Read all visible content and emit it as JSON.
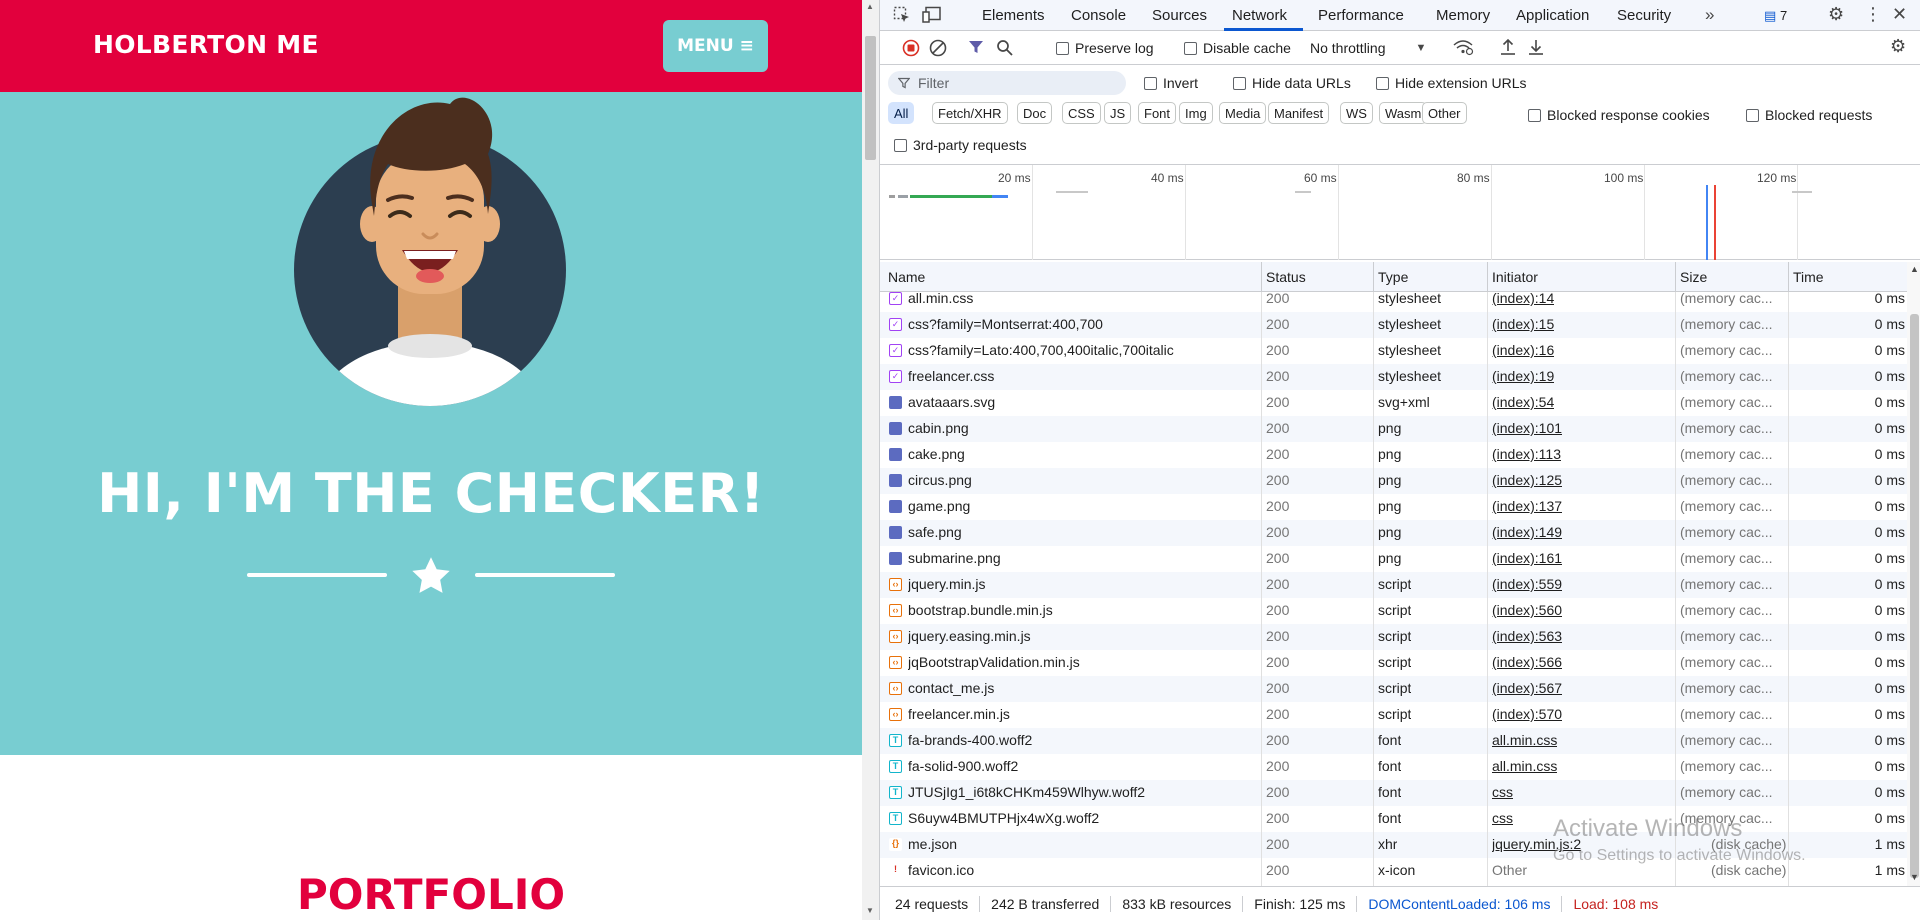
{
  "site": {
    "brand": "HOLBERTON ME",
    "menu_label": "MENU",
    "hero_title": "HI, I'M THE CHECKER!",
    "section_title": "PORTFOLIO",
    "colors": {
      "nav": "#e2003d",
      "hero": "#78cdd1",
      "accent": "#e2003d"
    }
  },
  "devtools": {
    "tabs": [
      {
        "label": "Elements"
      },
      {
        "label": "Console"
      },
      {
        "label": "Sources"
      },
      {
        "label": "Network"
      },
      {
        "label": "Performance"
      },
      {
        "label": "Memory"
      },
      {
        "label": "Application"
      },
      {
        "label": "Security"
      }
    ],
    "active_tab": "Network",
    "issues_count": "7",
    "toolbar": {
      "preserve_log": "Preserve log",
      "disable_cache": "Disable cache",
      "throttling": "No throttling"
    },
    "filter": {
      "placeholder": "Filter",
      "invert": "Invert",
      "hide_data_urls": "Hide data URLs",
      "hide_extension_urls": "Hide extension URLs",
      "blocked_response_cookies": "Blocked response cookies",
      "blocked_requests": "Blocked requests",
      "third_party": "3rd-party requests",
      "types": [
        "All",
        "Fetch/XHR",
        "Doc",
        "CSS",
        "JS",
        "Font",
        "Img",
        "Media",
        "Manifest",
        "WS",
        "Wasm",
        "Other"
      ],
      "active_type": "All"
    },
    "overview_ticks": [
      "20 ms",
      "40 ms",
      "60 ms",
      "80 ms",
      "100 ms",
      "120 ms"
    ],
    "columns": {
      "name": "Name",
      "status": "Status",
      "type": "Type",
      "initiator": "Initiator",
      "size": "Size",
      "time": "Time"
    },
    "requests": [
      {
        "name": "all.min.css",
        "status": "200",
        "type": "stylesheet",
        "initiator": "(index):14",
        "size": "(memory cac...",
        "time": "0 ms",
        "icon": "css"
      },
      {
        "name": "css?family=Montserrat:400,700",
        "status": "200",
        "type": "stylesheet",
        "initiator": "(index):15",
        "size": "(memory cac...",
        "time": "0 ms",
        "icon": "css"
      },
      {
        "name": "css?family=Lato:400,700,400italic,700italic",
        "status": "200",
        "type": "stylesheet",
        "initiator": "(index):16",
        "size": "(memory cac...",
        "time": "0 ms",
        "icon": "css"
      },
      {
        "name": "freelancer.css",
        "status": "200",
        "type": "stylesheet",
        "initiator": "(index):19",
        "size": "(memory cac...",
        "time": "0 ms",
        "icon": "css"
      },
      {
        "name": "avataaars.svg",
        "status": "200",
        "type": "svg+xml",
        "initiator": "(index):54",
        "size": "(memory cac...",
        "time": "0 ms",
        "icon": "img"
      },
      {
        "name": "cabin.png",
        "status": "200",
        "type": "png",
        "initiator": "(index):101",
        "size": "(memory cac...",
        "time": "0 ms",
        "icon": "img"
      },
      {
        "name": "cake.png",
        "status": "200",
        "type": "png",
        "initiator": "(index):113",
        "size": "(memory cac...",
        "time": "0 ms",
        "icon": "img"
      },
      {
        "name": "circus.png",
        "status": "200",
        "type": "png",
        "initiator": "(index):125",
        "size": "(memory cac...",
        "time": "0 ms",
        "icon": "img"
      },
      {
        "name": "game.png",
        "status": "200",
        "type": "png",
        "initiator": "(index):137",
        "size": "(memory cac...",
        "time": "0 ms",
        "icon": "img"
      },
      {
        "name": "safe.png",
        "status": "200",
        "type": "png",
        "initiator": "(index):149",
        "size": "(memory cac...",
        "time": "0 ms",
        "icon": "img"
      },
      {
        "name": "submarine.png",
        "status": "200",
        "type": "png",
        "initiator": "(index):161",
        "size": "(memory cac...",
        "time": "0 ms",
        "icon": "img"
      },
      {
        "name": "jquery.min.js",
        "status": "200",
        "type": "script",
        "initiator": "(index):559",
        "size": "(memory cac...",
        "time": "0 ms",
        "icon": "js"
      },
      {
        "name": "bootstrap.bundle.min.js",
        "status": "200",
        "type": "script",
        "initiator": "(index):560",
        "size": "(memory cac...",
        "time": "0 ms",
        "icon": "js"
      },
      {
        "name": "jquery.easing.min.js",
        "status": "200",
        "type": "script",
        "initiator": "(index):563",
        "size": "(memory cac...",
        "time": "0 ms",
        "icon": "js"
      },
      {
        "name": "jqBootstrapValidation.min.js",
        "status": "200",
        "type": "script",
        "initiator": "(index):566",
        "size": "(memory cac...",
        "time": "0 ms",
        "icon": "js"
      },
      {
        "name": "contact_me.js",
        "status": "200",
        "type": "script",
        "initiator": "(index):567",
        "size": "(memory cac...",
        "time": "0 ms",
        "icon": "js"
      },
      {
        "name": "freelancer.min.js",
        "status": "200",
        "type": "script",
        "initiator": "(index):570",
        "size": "(memory cac...",
        "time": "0 ms",
        "icon": "js"
      },
      {
        "name": "fa-brands-400.woff2",
        "status": "200",
        "type": "font",
        "initiator": "all.min.css",
        "size": "(memory cac...",
        "time": "0 ms",
        "icon": "font"
      },
      {
        "name": "fa-solid-900.woff2",
        "status": "200",
        "type": "font",
        "initiator": "all.min.css",
        "size": "(memory cac...",
        "time": "0 ms",
        "icon": "font"
      },
      {
        "name": "JTUSjIg1_i6t8kCHKm459Wlhyw.woff2",
        "status": "200",
        "type": "font",
        "initiator": "css",
        "size": "(memory cac...",
        "time": "0 ms",
        "icon": "font"
      },
      {
        "name": "S6uyw4BMUTPHjx4wXg.woff2",
        "status": "200",
        "type": "font",
        "initiator": "css",
        "size": "(memory cac...",
        "time": "0 ms",
        "icon": "font"
      },
      {
        "name": "me.json",
        "status": "200",
        "type": "xhr",
        "initiator": "jquery.min.js:2",
        "size": "(disk cache)",
        "time": "1 ms",
        "icon": "xhr"
      },
      {
        "name": "favicon.ico",
        "status": "200",
        "type": "x-icon",
        "initiator": "Other",
        "size": "(disk cache)",
        "time": "1 ms",
        "icon": "ico"
      }
    ],
    "summary": {
      "requests": "24 requests",
      "transferred": "242 B transferred",
      "resources": "833 kB resources",
      "finish": "Finish: 125 ms",
      "dom_loaded": "DOMContentLoaded: 106 ms",
      "load": "Load: 108 ms"
    }
  },
  "watermark": {
    "line1": "Activate Windows",
    "line2": "Go to Settings to activate Windows."
  }
}
